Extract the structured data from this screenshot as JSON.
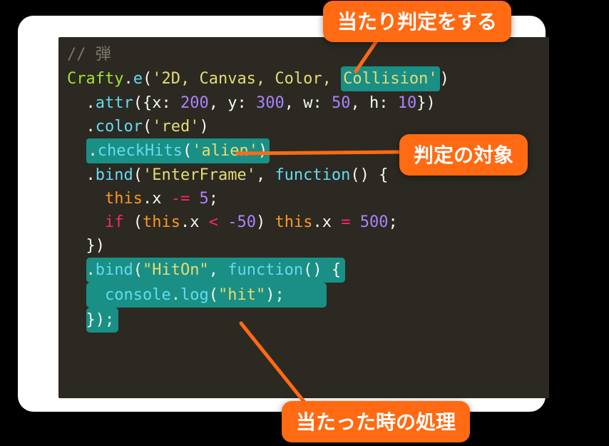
{
  "annotations": {
    "collision_check": "当たり判定をする",
    "target": "判定の対象",
    "on_hit": "当たった時の処理"
  },
  "code": {
    "comment": "// 弾",
    "obj": "Crafty",
    "method_e": "e",
    "str_components": "'2D, Canvas, Color, ",
    "str_collision": "Collision'",
    "attr": "attr",
    "key_x": "x",
    "val_x": "200",
    "key_y": "y",
    "val_y": "300",
    "key_w": "w",
    "val_w": "50",
    "key_h": "h",
    "val_h": "10",
    "color": "color",
    "str_red": "'red'",
    "checkHits": "checkHits",
    "str_alien": "'alien'",
    "bind": "bind",
    "str_enterframe": "'EnterFrame'",
    "kw_function": "function",
    "this_x": "this",
    "prop_x": "x",
    "minus_eq": "-=",
    "five": "5",
    "kw_if": "if",
    "lt": "<",
    "neg50": "-50",
    "eq": "=",
    "five_hundred": "500",
    "str_hiton": "\"HitOn\"",
    "console": "console",
    "log": "log",
    "str_hit": "\"hit\""
  }
}
